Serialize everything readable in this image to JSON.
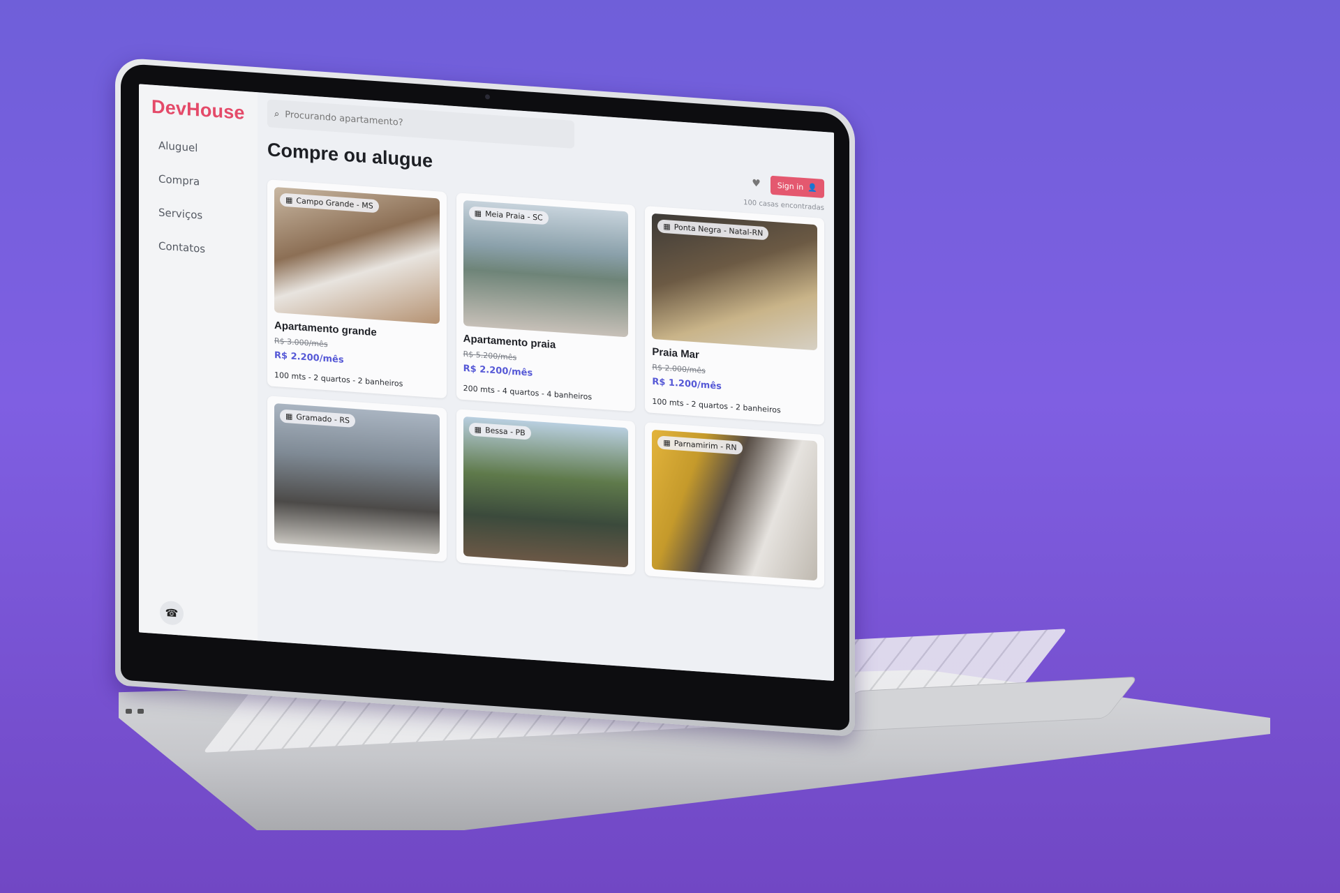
{
  "app": {
    "logo": "DevHouse"
  },
  "sidebar": {
    "items": [
      {
        "label": "Aluguel"
      },
      {
        "label": "Compra"
      },
      {
        "label": "Serviços"
      },
      {
        "label": "Contatos"
      }
    ],
    "phone_icon": "phone-icon"
  },
  "search": {
    "placeholder": "Procurando apartamento?",
    "icon": "search-icon"
  },
  "page": {
    "title": "Compre ou alugue",
    "signin_label": "Sign in",
    "results_count": "100 casas encontradas"
  },
  "listings": [
    {
      "location": "Campo Grande - MS",
      "title": "Apartamento grande",
      "old_price": "R$ 3.000/mês",
      "price": "R$ 2.200/mês",
      "details": "100 mts - 2 quartos - 2 banheiros"
    },
    {
      "location": "Meia Praia - SC",
      "title": "Apartamento praia",
      "old_price": "R$ 5.200/mês",
      "price": "R$ 2.200/mês",
      "details": "200 mts - 4 quartos - 4 banheiros"
    },
    {
      "location": "Ponta Negra - Natal-RN",
      "title": "Praia Mar",
      "old_price": "R$ 2.000/mês",
      "price": "R$ 1.200/mês",
      "details": "100 mts - 2 quartos - 2 banheiros"
    },
    {
      "location": "Gramado - RS"
    },
    {
      "location": "Bessa - PB"
    },
    {
      "location": "Parnamirim - RN"
    }
  ],
  "colors": {
    "brand": "#e44a69",
    "price": "#5558d6",
    "background": "#7b5fe0"
  }
}
